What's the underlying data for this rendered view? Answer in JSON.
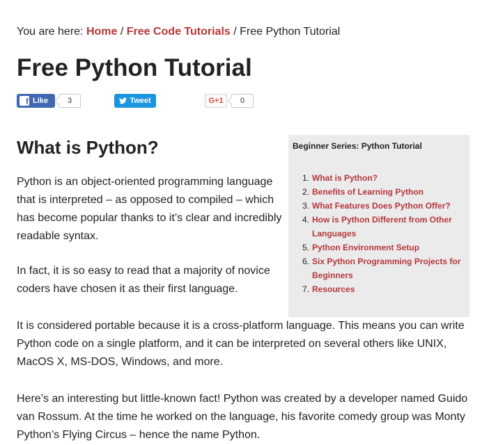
{
  "breadcrumb": {
    "prefix": "You are here: ",
    "home": "Home",
    "sep1": " / ",
    "tutorials": "Free Code Tutorials",
    "sep2": " / ",
    "current": "Free Python Tutorial"
  },
  "page_title": "Free Python Tutorial",
  "social": {
    "fb_logo": "f",
    "fb_like_label": "Like",
    "fb_count": "3",
    "tweet_label": "Tweet",
    "gplus_label": "G+1",
    "gplus_count": "0",
    "fb_color": "#4267b2",
    "twitter_color": "#1b95e0",
    "gplus_color": "#dd4b39",
    "icons": [
      "facebook-icon",
      "twitter-bird-icon",
      "google-plus-icon"
    ]
  },
  "section_heading": "What is Python?",
  "paragraphs": [
    "Python is an object-oriented programming language that is interpreted – as opposed to compiled – which has become popular thanks to it’s clear and incredibly readable syntax.",
    "In fact, it is so easy to read that a majority of novice coders have chosen it as their first language.",
    "It is considered portable because it is a cross-platform language. This means you can write Python code on a single platform, and it can be interpreted on several others like UNIX, MacOS X, MS-DOS, Windows, and more.",
    "Here’s an interesting but little-known fact! Python was created by a developer named Guido van Rossum. At the time he worked on the language, his favorite comedy group was Monty Python’s Flying Circus – hence the name Python."
  ],
  "sidebar": {
    "title": "Beginner Series: Python Tutorial",
    "items": [
      {
        "num": "1.",
        "label": "What is Python?"
      },
      {
        "num": "2.",
        "label": "Benefits of Learning Python"
      },
      {
        "num": "3.",
        "label": "What Features Does Python Offer?"
      },
      {
        "num": "4.",
        "label": "How is Python Different from Other Languages"
      },
      {
        "num": "5.",
        "label": "Python Environment Setup"
      },
      {
        "num": "6.",
        "label": "Six Python Programming Projects for Beginners"
      },
      {
        "num": "7.",
        "label": "Resources"
      }
    ]
  },
  "colors": {
    "link": "#b5373b",
    "text": "#222222",
    "sidebar_bg": "#ebebeb"
  }
}
